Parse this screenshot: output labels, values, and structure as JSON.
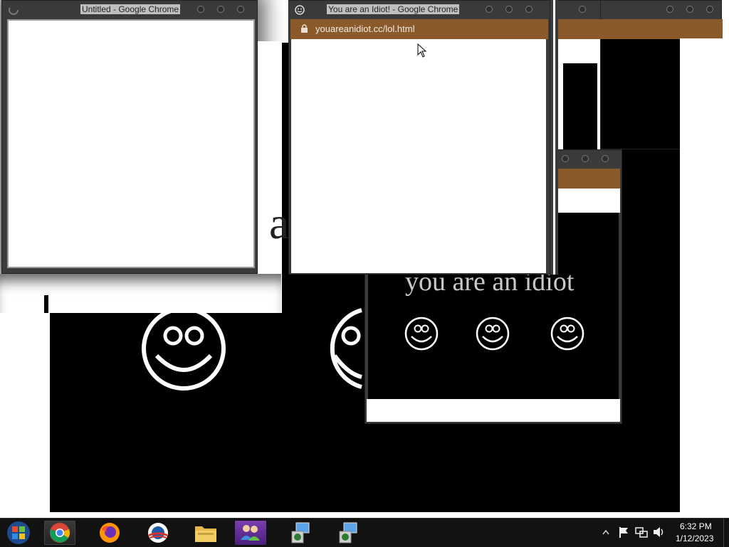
{
  "windows": {
    "untitled": {
      "title": "Untitled - Google Chrome"
    },
    "idiot_main": {
      "title": "You are an Idiot! - Google Chrome",
      "url": "youareanidiot.cc/lol.html"
    },
    "idiot_small": {
      "headline": "you are an idiot"
    },
    "background_page": {
      "partial_text": "a"
    }
  },
  "taskbar": {
    "items": [
      {
        "name": "start-button",
        "icon": "windows-start-icon"
      },
      {
        "name": "chrome",
        "icon": "chrome-icon",
        "active": true
      },
      {
        "name": "firefox",
        "icon": "firefox-icon"
      },
      {
        "name": "obama-logo",
        "icon": "circle-logo-icon"
      },
      {
        "name": "file-explorer",
        "icon": "folder-icon"
      },
      {
        "name": "users-app",
        "icon": "users-icon",
        "highlight": "purple"
      },
      {
        "name": "installer-1",
        "icon": "installer-icon"
      },
      {
        "name": "installer-2",
        "icon": "installer-icon"
      }
    ],
    "time": "6:32 PM",
    "date": "1/12/2023"
  },
  "colors": {
    "brown_bar": "#8b5a2b",
    "window_frame": "#3b3b3b",
    "taskbar": "#121212"
  }
}
